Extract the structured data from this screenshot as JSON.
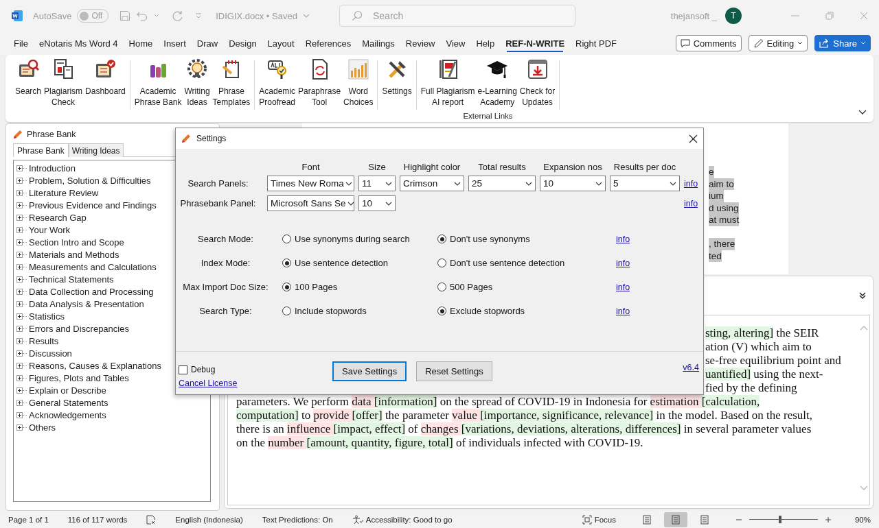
{
  "title_bar": {
    "autosave_label": "AutoSave",
    "autosave_toggle": {
      "on": false,
      "label": "Off"
    },
    "document_name": "IDIGIX.docx • Saved",
    "search": {
      "placeholder": "Search"
    },
    "user_name": "thejansoft _",
    "avatar_initial": "T"
  },
  "menu_tabs": [
    {
      "label": "File",
      "selected": false
    },
    {
      "label": "eNotaris Ms Word 4",
      "selected": false
    },
    {
      "label": "Home",
      "selected": false
    },
    {
      "label": "Insert",
      "selected": false
    },
    {
      "label": "Draw",
      "selected": false
    },
    {
      "label": "Design",
      "selected": false
    },
    {
      "label": "Layout",
      "selected": false
    },
    {
      "label": "References",
      "selected": false
    },
    {
      "label": "Mailings",
      "selected": false
    },
    {
      "label": "Review",
      "selected": false
    },
    {
      "label": "View",
      "selected": false
    },
    {
      "label": "Help",
      "selected": false
    },
    {
      "label": "REF-N-WRITE",
      "selected": true
    },
    {
      "label": "Right PDF",
      "selected": false
    }
  ],
  "header_buttons": {
    "comments": "Comments",
    "editing": "Editing",
    "share": "Share"
  },
  "ribbon": {
    "groups": [
      {
        "buttons": [
          {
            "lines": [
              "Search"
            ]
          },
          {
            "lines": [
              "Plagiarism",
              "Check"
            ]
          },
          {
            "lines": [
              "Dashboard"
            ]
          }
        ]
      },
      {
        "buttons": [
          {
            "lines": [
              "Academic",
              "Phrase Bank"
            ]
          },
          {
            "lines": [
              "Writing",
              "Ideas"
            ]
          },
          {
            "lines": [
              "Phrase",
              "Templates"
            ]
          }
        ]
      },
      {
        "buttons": [
          {
            "lines": [
              "Academic",
              "Proofread"
            ]
          },
          {
            "lines": [
              "Paraphrase",
              "Tool"
            ]
          },
          {
            "lines": [
              "Word",
              "Choices"
            ]
          }
        ]
      },
      {
        "buttons": [
          {
            "lines": [
              "Settings"
            ]
          }
        ]
      },
      {
        "label": "External Links",
        "buttons": [
          {
            "lines": [
              "Full Plagiarism",
              "AI report"
            ]
          },
          {
            "lines": [
              "e-Learning",
              "Academy"
            ]
          },
          {
            "lines": [
              "Check for",
              "Updates"
            ]
          }
        ]
      }
    ]
  },
  "phrase_bank_panel": {
    "title": "Phrase Bank",
    "tabs": [
      {
        "label": "Phrase Bank",
        "selected": true
      },
      {
        "label": "Writing Ideas",
        "selected": false
      }
    ],
    "tree": [
      {
        "label": "Introduction",
        "expanded": false
      },
      {
        "label": "Problem, Solution & Difficulties",
        "expanded": false
      },
      {
        "label": "Literature Review",
        "expanded": false
      },
      {
        "label": "Previous Evidence and Findings",
        "expanded": false
      },
      {
        "label": "Research Gap",
        "expanded": false
      },
      {
        "label": "Your Work",
        "expanded": false
      },
      {
        "label": "Section Intro and Scope",
        "expanded": false
      },
      {
        "label": "Materials and Methods",
        "expanded": false
      },
      {
        "label": "Measurements and Calculations",
        "expanded": false
      },
      {
        "label": "Technical Statements",
        "expanded": false
      },
      {
        "label": "Data Collection and Processing",
        "expanded": false
      },
      {
        "label": "Data Analysis & Presentation",
        "expanded": false
      },
      {
        "label": "Statistics",
        "expanded": false
      },
      {
        "label": "Errors and Discrepancies",
        "expanded": false
      },
      {
        "label": "Results",
        "expanded": false
      },
      {
        "label": "Discussion",
        "expanded": false
      },
      {
        "label": "Reasons, Causes & Explanations",
        "expanded": false
      },
      {
        "label": "Figures, Plots and Tables",
        "expanded": false
      },
      {
        "label": "Explain or Describe",
        "expanded": false
      },
      {
        "label": "General Statements",
        "expanded": false
      },
      {
        "label": "Acknowledgements",
        "expanded": false
      },
      {
        "label": "Others",
        "expanded": false
      }
    ]
  },
  "page_fragments": [
    [
      "e",
      "aim to",
      "ium",
      "d using",
      "at must"
    ],
    [
      ", there",
      "ted"
    ]
  ],
  "preview": {
    "partial_lines": [
      [
        {
          "text": "sting, altering]",
          "kind": "synonym"
        },
        {
          "text": " the SEIR",
          "kind": "plain"
        }
      ],
      [
        {
          "text": "ation (V) which aim to",
          "kind": "plain"
        }
      ],
      [
        {
          "text": "se-free equilibrium point and",
          "kind": "plain"
        }
      ],
      [
        {
          "text": "uantified]",
          "kind": "synonym"
        },
        {
          "text": " using the next-",
          "kind": "plain"
        }
      ],
      [
        {
          "text": "fied by the defining",
          "kind": "plain"
        }
      ]
    ],
    "lines": [
      [
        {
          "text": "parameters. We perform ",
          "kind": "plain"
        },
        {
          "text": "data ",
          "kind": "original"
        },
        {
          "text": "[information]",
          "kind": "synonym"
        },
        {
          "text": " on the spread of COVID-19 in Indonesia for ",
          "kind": "plain"
        },
        {
          "text": "estimation ",
          "kind": "original"
        },
        {
          "text": "[calculation,",
          "kind": "synonym"
        }
      ],
      [
        {
          "text": "computation]",
          "kind": "synonym"
        },
        {
          "text": " to ",
          "kind": "plain"
        },
        {
          "text": "provide ",
          "kind": "original"
        },
        {
          "text": "[offer]",
          "kind": "synonym"
        },
        {
          "text": " the parameter ",
          "kind": "plain"
        },
        {
          "text": "value ",
          "kind": "original"
        },
        {
          "text": "[importance, significance, relevance]",
          "kind": "synonym"
        },
        {
          "text": " in the model. Based on the result,",
          "kind": "plain"
        }
      ],
      [
        {
          "text": "there is an ",
          "kind": "plain"
        },
        {
          "text": "influence ",
          "kind": "original"
        },
        {
          "text": "[impact, effect]",
          "kind": "synonym"
        },
        {
          "text": " of ",
          "kind": "plain"
        },
        {
          "text": "changes ",
          "kind": "original"
        },
        {
          "text": "[variations, deviations, alterations, differences]",
          "kind": "synonym"
        },
        {
          "text": " in several parameter values",
          "kind": "plain"
        }
      ],
      [
        {
          "text": "on the ",
          "kind": "plain"
        },
        {
          "text": "number ",
          "kind": "original"
        },
        {
          "text": "[amount, quantity, figure, total]",
          "kind": "synonym"
        },
        {
          "text": " of individuals infected with COVID-19.",
          "kind": "plain"
        }
      ]
    ]
  },
  "settings_dialog": {
    "title": "Settings",
    "columns": [
      "Font",
      "Size",
      "Highlight color",
      "Total results",
      "Expansion nos",
      "Results per doc"
    ],
    "panel_rows": [
      {
        "label": "Search Panels:",
        "values": [
          "Times New Roma",
          "11",
          "Crimson",
          "25",
          "10",
          "5"
        ],
        "link": "info"
      },
      {
        "label": "Phrasebank Panel:",
        "values": [
          "Microsoft Sans Se",
          "10"
        ],
        "link": "info"
      }
    ],
    "option_rows": [
      {
        "label": "Search Mode:",
        "options": [
          {
            "label": "Use synonyms during search",
            "selected": false
          },
          {
            "label": "Don't use synonyms",
            "selected": true
          }
        ],
        "link": "info"
      },
      {
        "label": "Index Mode:",
        "options": [
          {
            "label": "Use sentence detection",
            "selected": true
          },
          {
            "label": "Don't use sentence detection",
            "selected": false
          }
        ],
        "link": "info"
      },
      {
        "label": "Max Import Doc Size:",
        "options": [
          {
            "label": "100 Pages",
            "selected": true
          },
          {
            "label": "500 Pages",
            "selected": false
          }
        ],
        "link": "info"
      },
      {
        "label": "Search Type:",
        "options": [
          {
            "label": "Include stopwords",
            "selected": false
          },
          {
            "label": "Exclude stopwords",
            "selected": true
          }
        ],
        "link": "info"
      }
    ],
    "debug": {
      "label": "Debug",
      "checked": false
    },
    "cancel_license": "Cancel License",
    "buttons": [
      {
        "label": "Save Settings",
        "selected": true
      },
      {
        "label": "Reset Settings",
        "selected": false
      }
    ],
    "version": "v6.4"
  },
  "status_bar": {
    "page": "Page 1 of 1",
    "words": "116 of 117 words",
    "language": "English (Indonesia)",
    "predictions": "Text Predictions: On",
    "accessibility": "Accessibility: Good to go",
    "focus": "Focus",
    "views": [
      {
        "selected": false
      },
      {
        "selected": true
      },
      {
        "selected": false
      }
    ],
    "zoom": {
      "level": 0.45,
      "reading": "90%"
    }
  }
}
